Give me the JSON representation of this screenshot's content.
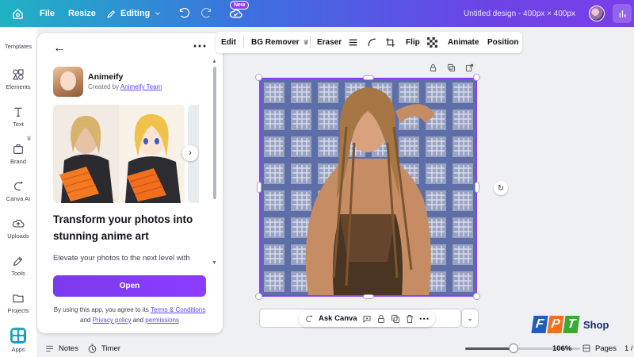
{
  "topbar": {
    "file_label": "File",
    "resize_label": "Resize",
    "editing_label": "Editing",
    "new_badge": "New",
    "design_title": "Untitled design - 400px × 400px"
  },
  "sidebar": {
    "items": [
      {
        "label": "Templates",
        "icon": "templates-icon"
      },
      {
        "label": "Elements",
        "icon": "elements-icon"
      },
      {
        "label": "Text",
        "icon": "text-icon"
      },
      {
        "label": "Brand",
        "icon": "brand-icon"
      },
      {
        "label": "Canva AI",
        "icon": "canva-ai-icon"
      },
      {
        "label": "Uploads",
        "icon": "uploads-icon"
      },
      {
        "label": "Tools",
        "icon": "tools-icon"
      },
      {
        "label": "Projects",
        "icon": "projects-icon"
      },
      {
        "label": "Apps",
        "icon": "apps-icon"
      }
    ]
  },
  "panel": {
    "app_name": "Animeify",
    "created_by_prefix": "Created by ",
    "created_by_link": "Animeify Team",
    "headline": "Transform your photos into stunning anime art",
    "description": "Elevate your photos to the next level with",
    "open_label": "Open",
    "terms_prefix": "By using this app, you agree to its ",
    "terms_link": "Terms & Conditions",
    "terms_and": " and ",
    "privacy_link": "Privacy policy",
    "terms_and2": " and ",
    "permissions_link": "permissions"
  },
  "image_toolbar": {
    "edit_label": "Edit",
    "bg_remover_label": "BG Remover",
    "eraser_label": "Eraser",
    "flip_label": "Flip",
    "animate_label": "Animate",
    "position_label": "Position"
  },
  "canvas_bar": {
    "ask_label": "Ask Canva"
  },
  "bottom": {
    "notes_label": "Notes",
    "timer_label": "Timer",
    "zoom_value": "106%",
    "zoom_level": 0.42,
    "pages_label": "Pages",
    "page_number": "1 /"
  },
  "watermark": {
    "letters": [
      "F",
      "P",
      "T"
    ],
    "shop": "Shop"
  },
  "colors": {
    "accent": "#8b3dff",
    "topbar_start": "#1fb3c4",
    "topbar_end": "#7b3ee8",
    "fpt_orange": "#f26f21",
    "fpt_blue": "#1f5fb8",
    "fpt_green": "#3aa935"
  }
}
